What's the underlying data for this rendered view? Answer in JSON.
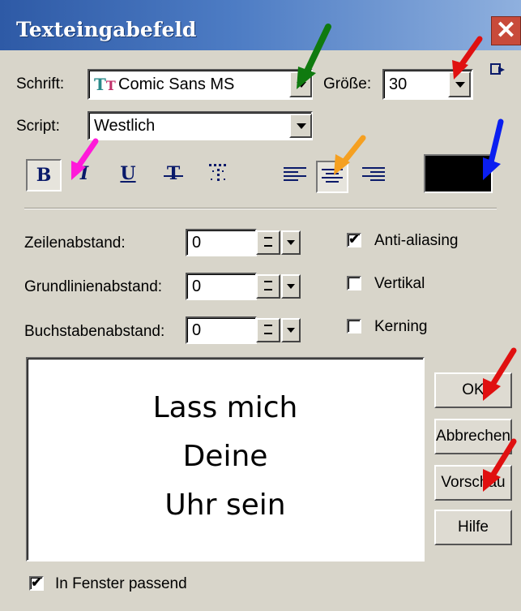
{
  "window": {
    "title": "Texteingabefeld"
  },
  "font": {
    "label": "Schrift:",
    "value": "Comic Sans MS"
  },
  "size": {
    "label": "Größe:",
    "value": "30"
  },
  "script": {
    "label": "Script:",
    "value": "Westlich"
  },
  "format": {
    "bold": "B",
    "italic": "I",
    "underline": "U",
    "strike": "T"
  },
  "spacing": {
    "line": {
      "label": "Zeilenabstand:",
      "value": "0"
    },
    "baseline": {
      "label": "Grundlinienabstand:",
      "value": "0"
    },
    "letter": {
      "label": "Buchstabenabstand:",
      "value": "0"
    }
  },
  "options": {
    "antialias": {
      "label": "Anti-aliasing",
      "checked": true,
      "mark": "✔"
    },
    "vertical": {
      "label": "Vertikal",
      "checked": false
    },
    "kerning": {
      "label": "Kerning",
      "checked": false
    }
  },
  "preview": {
    "lines": [
      "Lass mich",
      "Deine",
      "Uhr sein"
    ]
  },
  "buttons": {
    "ok": "OK",
    "cancel": "Abbrechen",
    "preview": "Vorschau",
    "help": "Hilfe"
  },
  "fit_window": {
    "label": "In Fenster passend",
    "checked": true,
    "mark": "✔"
  },
  "colors": {
    "text_color": "#000000",
    "arrow_green": "#0f7a0f",
    "arrow_red": "#e01010",
    "arrow_magenta": "#ff1ad9",
    "arrow_orange": "#f5a021",
    "arrow_blue": "#0a1ef0"
  }
}
